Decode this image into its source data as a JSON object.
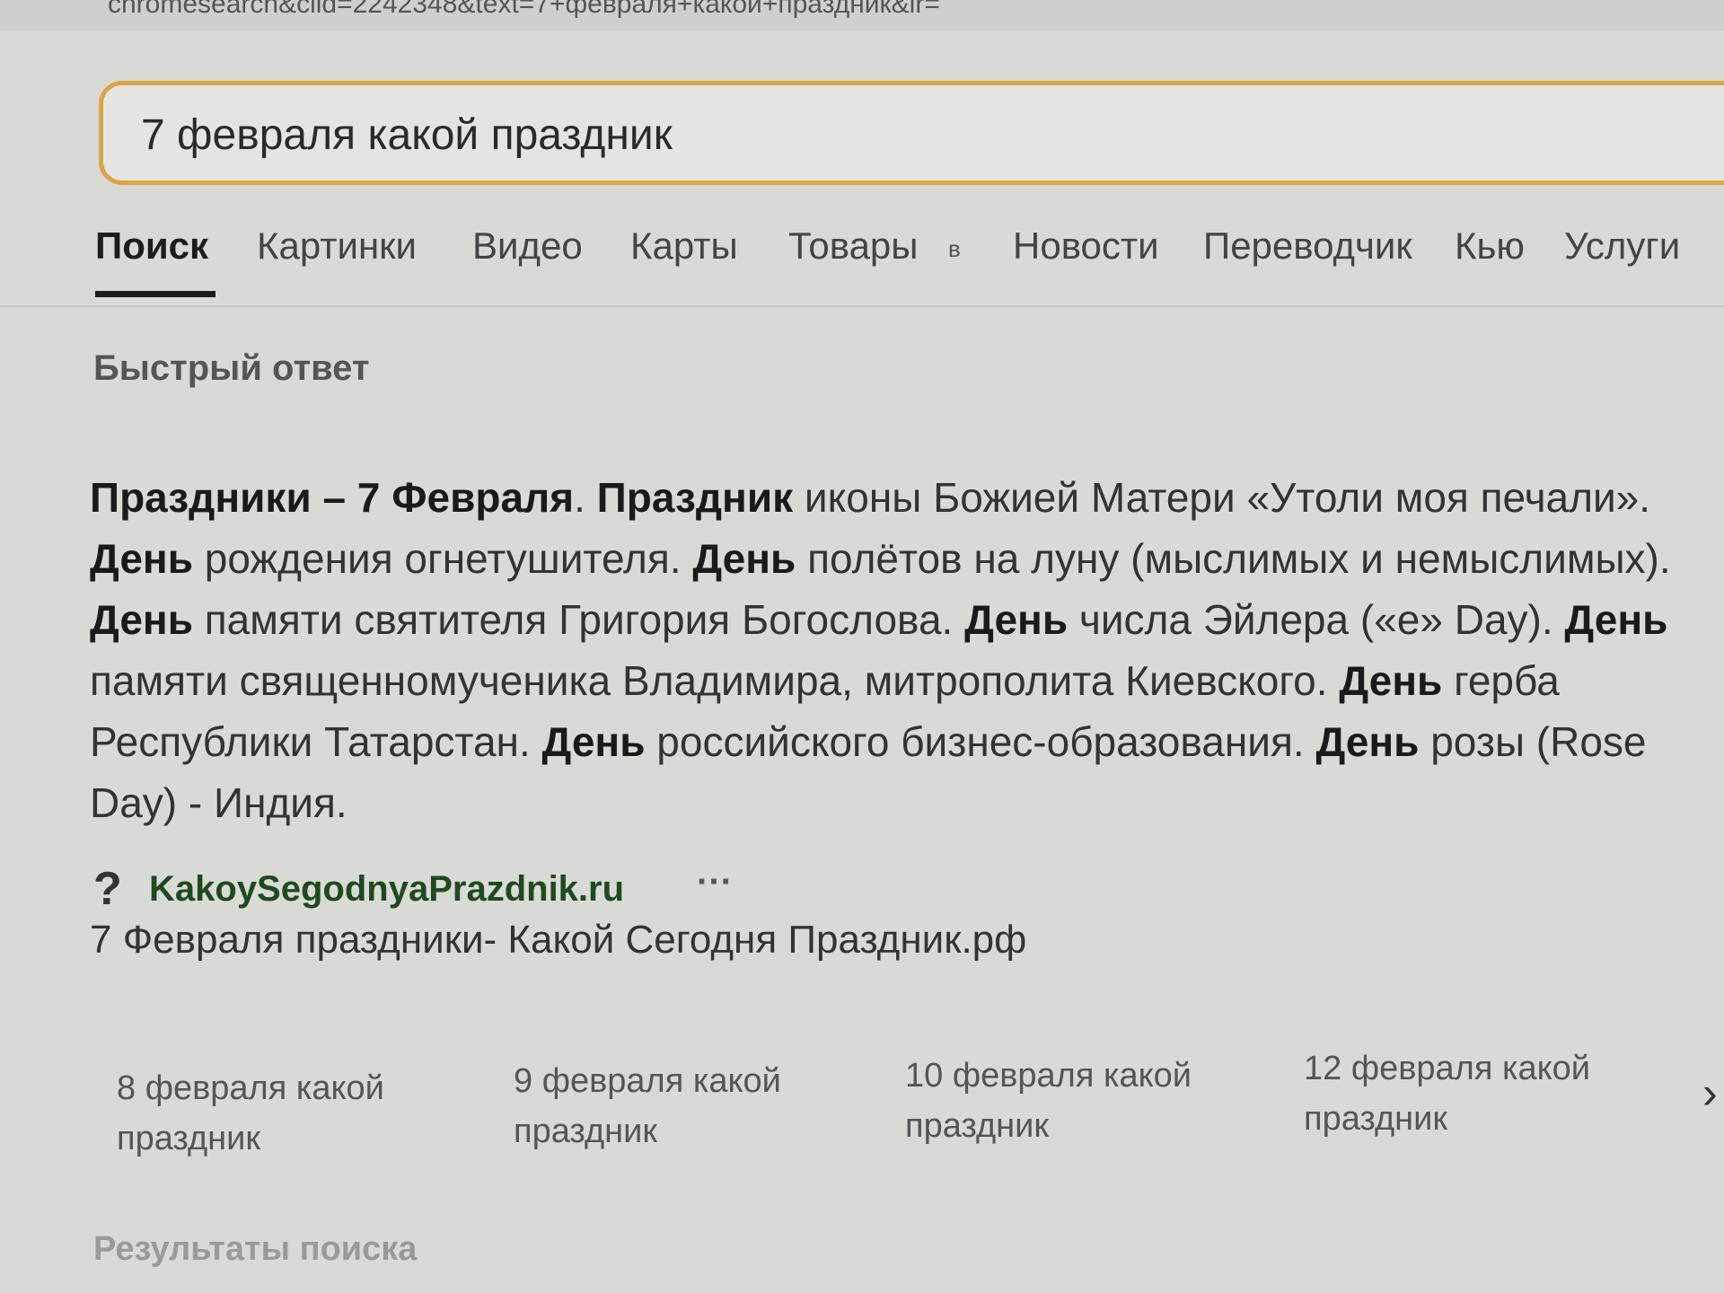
{
  "browser": {
    "url_fragment": "chromesearch&clid=2242348&text=7+февраля+какой+праздник&lr="
  },
  "search": {
    "query": "7 февраля какой праздник"
  },
  "tabs": [
    {
      "label": "Поиск"
    },
    {
      "label": "Картинки"
    },
    {
      "label": "Видео"
    },
    {
      "label": "Карты"
    },
    {
      "label": "Товары"
    },
    {
      "label": "Новости"
    },
    {
      "label": "Переводчик"
    },
    {
      "label": "Кью"
    },
    {
      "label": "Услуги"
    }
  ],
  "tabs_badge": "в",
  "quick_answer": {
    "title": "Быстрый ответ",
    "segments": [
      {
        "t": "Праздники – 7 Февраля",
        "b": true
      },
      {
        "t": ". ",
        "b": false
      },
      {
        "t": "Праздник",
        "b": true
      },
      {
        "t": " иконы Божией Матери «Утоли моя печали». ",
        "b": false
      },
      {
        "t": "День",
        "b": true
      },
      {
        "t": " рождения огнетушителя. ",
        "b": false
      },
      {
        "t": "День",
        "b": true
      },
      {
        "t": " полётов на луну (мыслимых и немыслимых). ",
        "b": false
      },
      {
        "t": "День",
        "b": true
      },
      {
        "t": " памяти святителя Григория Богослова. ",
        "b": false
      },
      {
        "t": "День",
        "b": true
      },
      {
        "t": " числа Эйлера («e» Day). ",
        "b": false
      },
      {
        "t": "День",
        "b": true
      },
      {
        "t": " памяти священномученика Владимира, митрополита Киевского. ",
        "b": false
      },
      {
        "t": "День",
        "b": true
      },
      {
        "t": " герба Республики Татарстан. ",
        "b": false
      },
      {
        "t": "День",
        "b": true
      },
      {
        "t": " российского бизнес-образования. ",
        "b": false
      },
      {
        "t": "День",
        "b": true
      },
      {
        "t": " розы (Rose Day) - Индия.",
        "b": false
      }
    ],
    "source": {
      "icon_glyph": "?",
      "domain": "KakoySegodnyaPrazdnik.ru",
      "more_glyph": "···",
      "title": "7 Февраля праздники- Какой Сегодня Праздник.рф"
    }
  },
  "related": [
    {
      "line1": "8 февраля какой",
      "line2": "праздник"
    },
    {
      "line1": "9 февраля какой",
      "line2": "праздник"
    },
    {
      "line1": "10 февраля какой",
      "line2": "праздник"
    },
    {
      "line1": "12 февраля какой",
      "line2": "праздник"
    }
  ],
  "related_arrow": "›",
  "results_title": "Результаты поиска"
}
